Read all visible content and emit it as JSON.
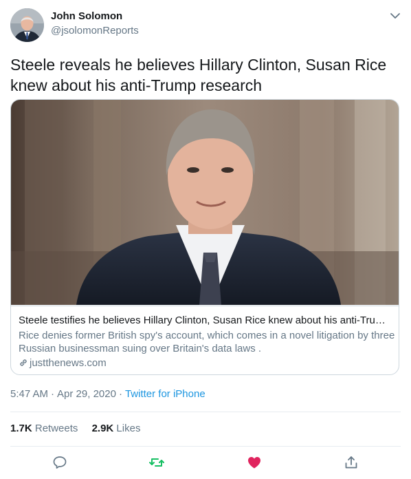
{
  "author": {
    "name": "John Solomon",
    "handle": "@jsolomonReports"
  },
  "tweet": {
    "text": "Steele reveals he believes Hillary Clinton, Susan Rice knew about his anti-Trump research"
  },
  "card": {
    "title": "Steele testifies he believes Hillary Clinton, Susan Rice knew about his anti-Trump ...",
    "description": "Rice denies former British spy's account, which comes in a novel litigation by three Russian businessman suing over Britain's data laws .",
    "domain": "justthenews.com"
  },
  "meta": {
    "time": "5:47 AM",
    "separator": "·",
    "date": "Apr 29, 2020",
    "source": "Twitter for iPhone"
  },
  "stats": {
    "retweets_count": "1.7K",
    "retweets_label": "Retweets",
    "likes_count": "2.9K",
    "likes_label": "Likes"
  },
  "icons": {
    "reply": "reply-icon",
    "retweet": "retweet-icon",
    "like": "heart-icon",
    "share": "share-icon",
    "caret": "chevron-down-icon",
    "link": "link-icon"
  },
  "colors": {
    "text": "#14171a",
    "secondary": "#657786",
    "link": "#1b95e0",
    "retweet": "#17bf63",
    "like": "#e0245e",
    "border": "#ccd6dd"
  }
}
